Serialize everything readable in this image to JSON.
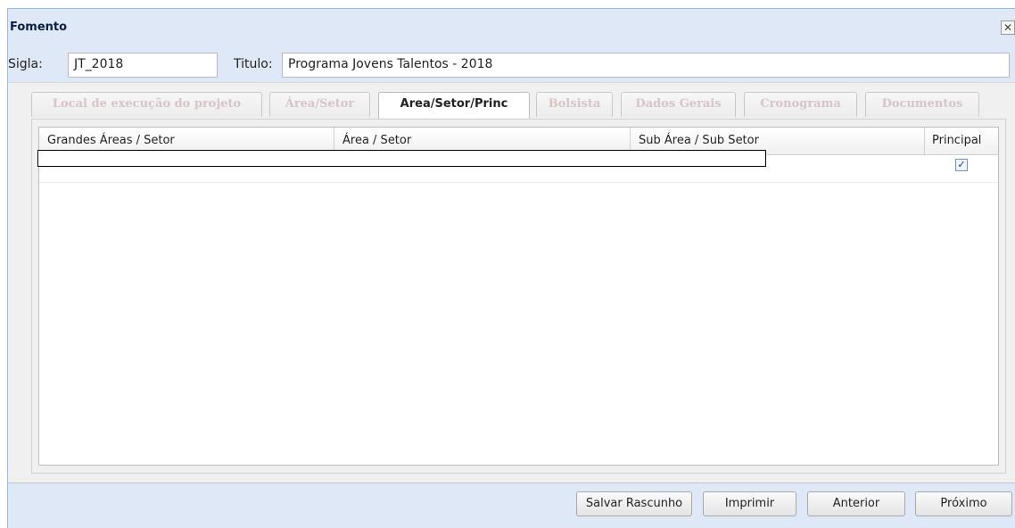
{
  "window": {
    "title": "Fomento",
    "close_icon": "close-icon",
    "close_glyph": "✕"
  },
  "form": {
    "sigla_label": "Sigla:",
    "sigla_value": "JT_2018",
    "titulo_label": "Titulo:",
    "titulo_value": "Programa Jovens Talentos - 2018"
  },
  "tabs": [
    "Local de execução do projeto",
    "Área/Setor",
    "Area/Setor/Princ",
    "Bolsista",
    "Dados Gerais",
    "Cronograma",
    "Documentos"
  ],
  "grid": {
    "columns": [
      "Grandes Áreas / Setor",
      "Área / Setor",
      "Sub Área / Sub Setor",
      "Principal"
    ],
    "rows": [
      {
        "principal_checked": true,
        "check_glyph": "✓"
      }
    ]
  },
  "buttons": {
    "save_draft": "Salvar Rascunho",
    "print": "Imprimir",
    "previous": "Anterior",
    "next": "Próximo"
  }
}
